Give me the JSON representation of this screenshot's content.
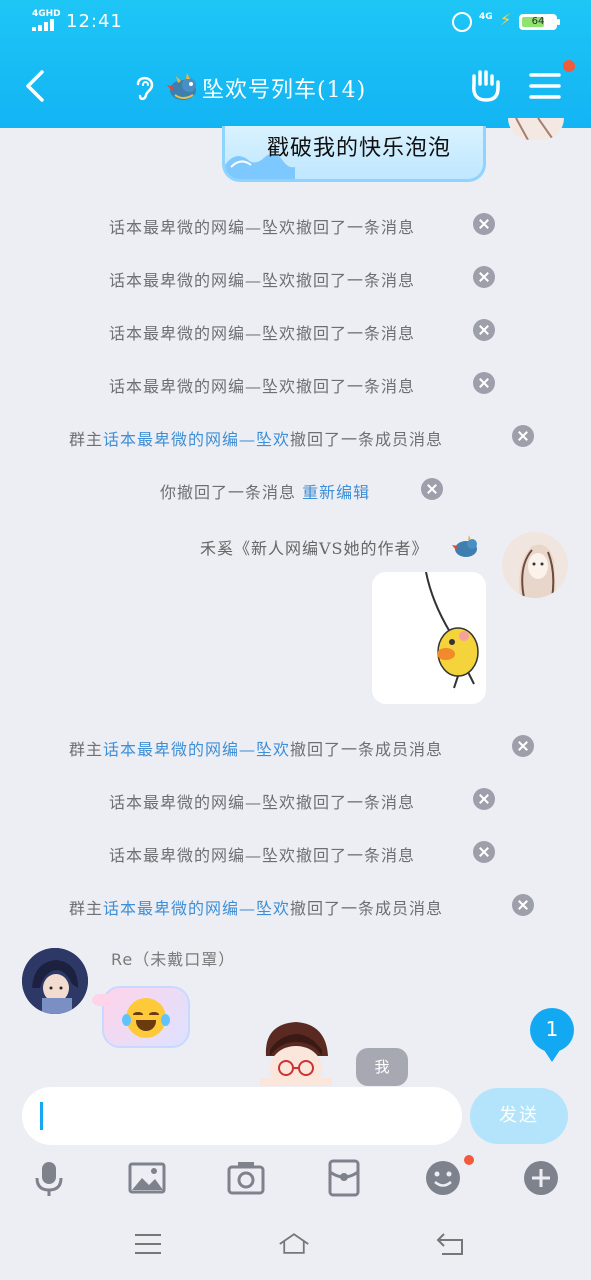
{
  "status_bar": {
    "network_label": "4GHD",
    "time": "12:41",
    "data_label": "4G",
    "battery": "64"
  },
  "header": {
    "title": "坠欢号列车(14)"
  },
  "messages": {
    "top_bubble_text": "戳破我的快乐泡泡",
    "recall_notices": [
      {
        "prefix": "",
        "name": "",
        "text": "话本最卑微的网编—坠欢撤回了一条消息"
      },
      {
        "prefix": "",
        "name": "",
        "text": "话本最卑微的网编—坠欢撤回了一条消息"
      },
      {
        "prefix": "",
        "name": "",
        "text": "话本最卑微的网编—坠欢撤回了一条消息"
      },
      {
        "prefix": "",
        "name": "",
        "text": "话本最卑微的网编—坠欢撤回了一条消息"
      },
      {
        "prefix": "群主",
        "name": "话本最卑微的网编—坠欢",
        "text": "撤回了一条成员消息"
      },
      {
        "prefix": "",
        "name": "",
        "text": "你撤回了一条消息",
        "action": "重新编辑"
      },
      {
        "prefix": "群主",
        "name": "话本最卑微的网编—坠欢",
        "text": "撤回了一条成员消息"
      },
      {
        "prefix": "",
        "name": "",
        "text": "话本最卑微的网编—坠欢撤回了一条消息"
      },
      {
        "prefix": "",
        "name": "",
        "text": "话本最卑微的网编—坠欢撤回了一条消息"
      },
      {
        "prefix": "群主",
        "name": "话本最卑微的网编—坠欢",
        "text": "撤回了一条成员消息"
      }
    ],
    "right_sender_name": "禾奚《新人网编VS她的作者》",
    "left_sender_name": "Re（未戴口罩）",
    "unread_count": "1",
    "me_tag": "我"
  },
  "composer": {
    "input_value": "",
    "send_label": "发送"
  },
  "colors": {
    "header": "#13b4f3",
    "link": "#3f8fd6",
    "send_button": "#b3e4fb",
    "badge": "#f25a3c"
  },
  "icons": [
    "back-icon",
    "ear-icon",
    "dragon-icon",
    "hand-icon",
    "menu-icon",
    "voice-icon",
    "image-icon",
    "camera-icon",
    "red-packet-icon",
    "emoji-icon",
    "plus-icon",
    "nav-menu-icon",
    "nav-home-icon",
    "nav-back-icon"
  ]
}
